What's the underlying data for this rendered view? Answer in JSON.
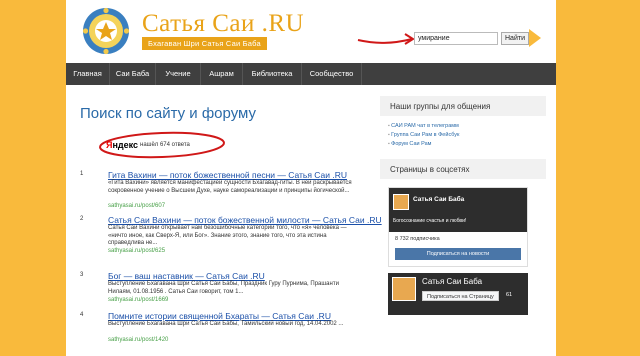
{
  "header": {
    "site_title": "Сатья Саи .RU",
    "subtitle": "Бхагаван Шри Сатья Саи Баба",
    "search_value": "умирание",
    "search_button": "Найти"
  },
  "nav": {
    "items": [
      "Главная",
      "Саи Баба",
      "Учение",
      "Ашрам",
      "Библиотека",
      "Сообщество"
    ]
  },
  "main": {
    "page_title": "Поиск по сайту и форуму",
    "yandex_logo_red": "Я",
    "yandex_logo_rest": "ндекс",
    "result_count": "нашёл 674 ответа",
    "results": [
      {
        "num": "1",
        "title": "Гита Вахини — поток божественной песни — Сатья Саи .RU",
        "snippet": "«Гита Вахини» является манифестацией сущности Бхагавад-гиты. В ней раскрывается сокровенное учение о Высшем Духе, науке самореализации и принципы йогической...",
        "url": "sathyasai.ru/post/607"
      },
      {
        "num": "2",
        "title": "Сатья Саи Вахини — поток божественной милости — Сатья Саи .RU",
        "snippet": "Сатья Саи Вахини открывает нам безошибочные категории того, что «я» человека — «ничто иное, как Сверх-Я, или Бог». Знание этого, знание того, что эта истина справедлива не...",
        "url": "sathyasai.ru/post/625"
      },
      {
        "num": "3",
        "title": "Бог — ваш наставник — Сатья Саи .RU",
        "snippet": "Выступление Бхагавана Шри Сатья Саи Бабы, Праздник Гуру Пурнима, Прашанти Нилаям, 01.08.1956 . Сатья Саи говорит, том 1...",
        "url": "sathyasai.ru/post/1669"
      },
      {
        "num": "4",
        "title": "Помните истории священной Бхараты — Сатья Саи .RU",
        "snippet": "Выступление Бхагавана Шри Сатья Саи Бабы, Тамильский новый год, 14.04.2002 ...",
        "url": "sathyasai.ru/post/1420"
      }
    ]
  },
  "sidebar": {
    "groups_title": "Наши группы для общения",
    "groups": [
      "САИ РАМ чат в телеграмм",
      "Группа Саи Рам в Фейсбук",
      "Форум Саи Рам"
    ],
    "social_title": "Страницы в соцсетях",
    "vk_name": "Сатья Саи Баба",
    "vk_tagline": "Богосознание счастья и любви!",
    "vk_followers": "8 732 подписчика",
    "vk_button": "Подписаться на новости",
    "fb_name": "Сатья Саи Баба",
    "fb_button": "Подписаться на Страницу",
    "fb_count": "61"
  },
  "colors": {
    "background": "#f9ba3c",
    "accent": "#e9a319",
    "nav_bg": "#3f3f3f",
    "link": "#1a4fa8",
    "title_blue": "#2a6aa8",
    "url_green": "#48a048",
    "annotation_red": "#d01818"
  }
}
